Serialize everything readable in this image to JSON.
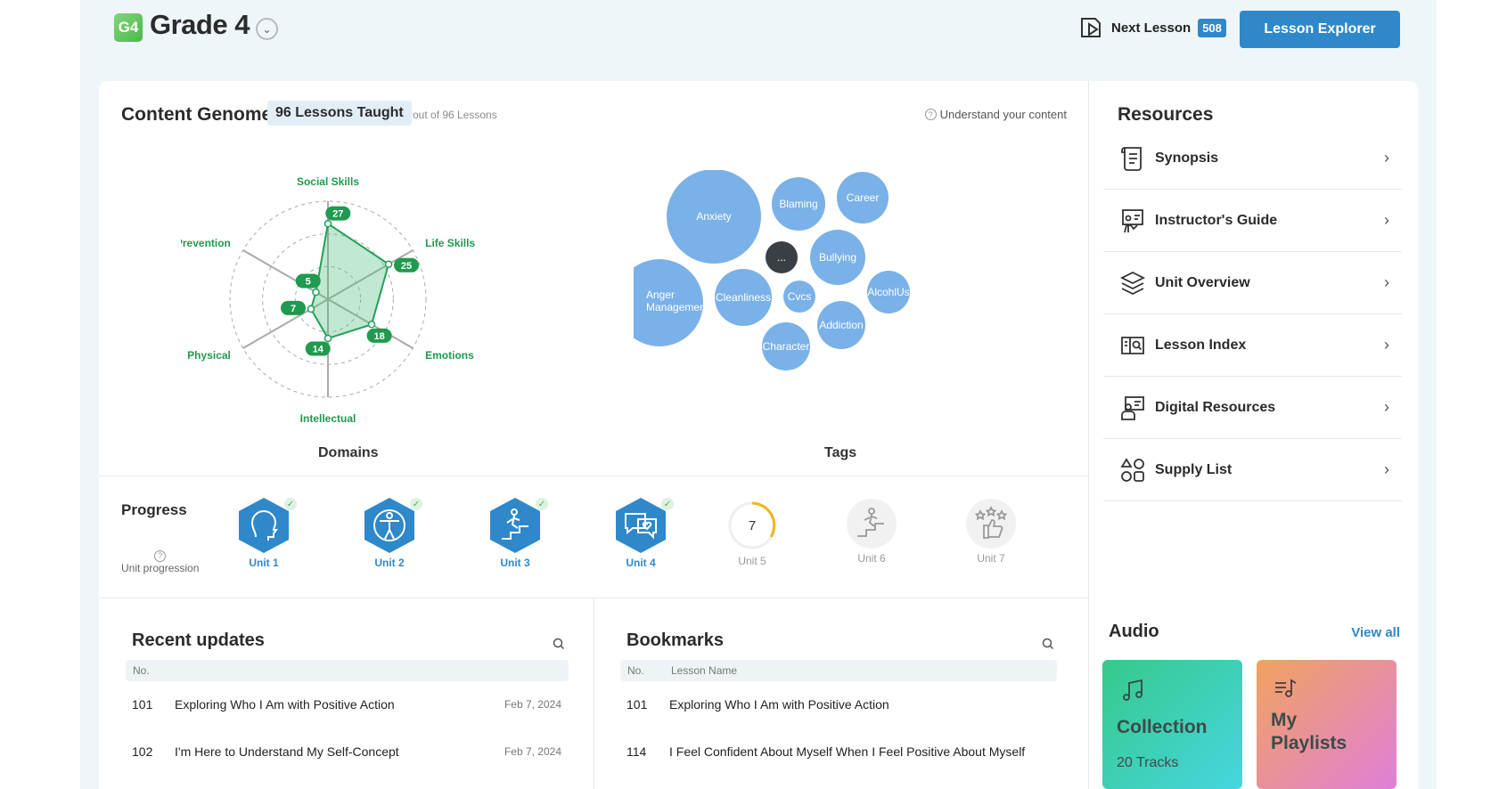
{
  "header": {
    "grade_badge": "G4",
    "grade_title": "Grade 4",
    "next_lesson_label": "Next Lesson",
    "next_lesson_num": "508",
    "explorer_label": "Lesson Explorer"
  },
  "genome": {
    "title": "Content Genome",
    "taught": "96 Lessons Taught",
    "out_of": "out of 96 Lessons",
    "understand": "Understand your content",
    "domains_label": "Domains",
    "tags_label": "Tags"
  },
  "chart_data": {
    "type": "radar",
    "axes": [
      "Social Skills",
      "Life Skills",
      "Emotions",
      "Intellectual",
      "Physical",
      "Prevention"
    ],
    "values": [
      27,
      25,
      18,
      14,
      7,
      5
    ],
    "color": "#22a05a"
  },
  "tags": [
    "Anxiety",
    "Blaming",
    "Career",
    "Bullying",
    "AlcohlUs",
    "Anger Management",
    "Cleanliness",
    "Cvcs",
    "Addiction",
    "Character",
    "..."
  ],
  "progress": {
    "title": "Progress",
    "help": "Unit progression",
    "units": [
      {
        "label": "Unit 1",
        "state": "done",
        "icon": "head-icon"
      },
      {
        "label": "Unit 2",
        "state": "done",
        "icon": "person-icon"
      },
      {
        "label": "Unit 3",
        "state": "done",
        "icon": "stairs-climber-icon"
      },
      {
        "label": "Unit 4",
        "state": "done",
        "icon": "chat-heart-icon"
      },
      {
        "label": "Unit 5",
        "state": "current",
        "value": "7"
      },
      {
        "label": "Unit 6",
        "state": "todo",
        "icon": "stairs-icon"
      },
      {
        "label": "Unit 7",
        "state": "todo",
        "icon": "thumbs-up-stars-icon"
      }
    ]
  },
  "recent": {
    "title": "Recent updates",
    "col_no": "No.",
    "rows": [
      {
        "no": "101",
        "name": "Exploring Who I Am with Positive Action",
        "date": "Feb 7, 2024"
      },
      {
        "no": "102",
        "name": "I'm Here to Understand My Self-Concept",
        "date": "Feb 7, 2024"
      }
    ]
  },
  "bookmarks": {
    "title": "Bookmarks",
    "col_no": "No.",
    "col_name": "Lesson Name",
    "rows": [
      {
        "no": "101",
        "name": "Exploring Who I Am with Positive Action"
      },
      {
        "no": "114",
        "name": "I Feel Confident About Myself When I Feel Positive About Myself"
      }
    ]
  },
  "resources": {
    "title": "Resources",
    "items": [
      {
        "label": "Synopsis",
        "icon": "scroll-icon"
      },
      {
        "label": "Instructor's Guide",
        "icon": "presenter-icon"
      },
      {
        "label": "Unit Overview",
        "icon": "layers-icon"
      },
      {
        "label": "Lesson Index",
        "icon": "book-search-icon"
      },
      {
        "label": "Digital Resources",
        "icon": "monitor-person-icon"
      },
      {
        "label": "Supply List",
        "icon": "shapes-icon"
      }
    ]
  },
  "audio": {
    "title": "Audio",
    "view_all": "View all",
    "collection_title": "Collection",
    "collection_count": "20 Tracks",
    "playlists_line1": "My",
    "playlists_line2": "Playlists"
  }
}
